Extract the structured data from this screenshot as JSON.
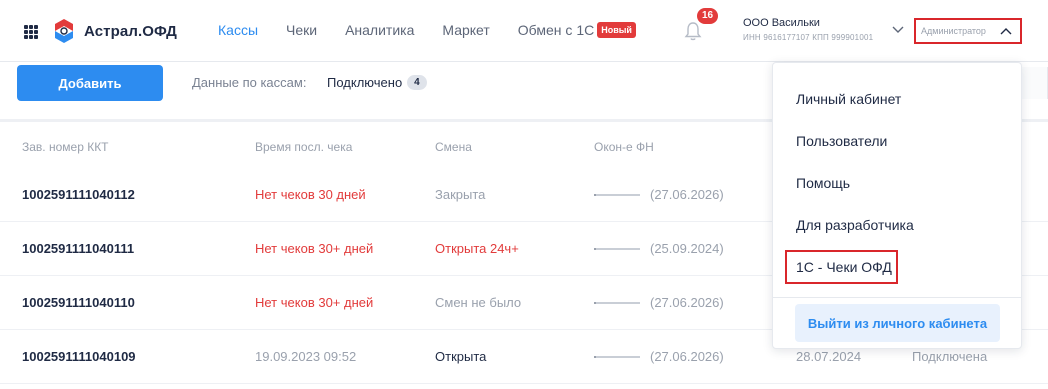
{
  "header": {
    "brand": "Астрал.ОФД",
    "nav": [
      {
        "label": "Кассы"
      },
      {
        "label": "Чеки"
      },
      {
        "label": "Аналитика"
      },
      {
        "label": "Маркет"
      },
      {
        "label": "Обмен с 1С",
        "badge": "Новый"
      }
    ],
    "notifications_count": "16",
    "org_name": "ООО Васильки",
    "org_ids": "ИНН 9616177107  КПП 999901001",
    "role": "Администратор"
  },
  "toolbar": {
    "add_label": "Добавить",
    "data_label": "Данные по кассам:",
    "connected_label": "Подключено",
    "connected_count": "4"
  },
  "table": {
    "columns": [
      "Зав. номер ККТ",
      "Время посл. чека",
      "Смена",
      "Окон-е ФН"
    ],
    "rows": [
      {
        "number": "1002591111040112",
        "last_check": "Нет чеков 30 дней",
        "shift": "Закрыта",
        "fn_end": "(27.06.2026)",
        "extra_date": "",
        "extra_status": ""
      },
      {
        "number": "1002591111040111",
        "last_check": "Нет чеков 30+ дней",
        "shift": "Открыта 24ч+",
        "fn_end": "(25.09.2024)",
        "extra_date": "",
        "extra_status": ""
      },
      {
        "number": "1002591111040110",
        "last_check": "Нет чеков 30+ дней",
        "shift": "Смен не было",
        "fn_end": "(27.06.2026)",
        "extra_date": "",
        "extra_status": ""
      },
      {
        "number": "1002591111040109",
        "last_check": "19.09.2023 09:52",
        "shift": "Открыта",
        "fn_end": "(27.06.2026)",
        "extra_date": "28.07.2024",
        "extra_status": "Подключена"
      }
    ]
  },
  "menu": {
    "items": [
      "Личный кабинет",
      "Пользователи",
      "Помощь",
      "Для разработчика",
      "1С - Чеки ОФД"
    ],
    "logout": "Выйти из личного кабинета"
  },
  "colors": {
    "accent": "#2d8cf0",
    "danger": "#e23b3b",
    "highlight_border": "#d9262b",
    "text": "#1f2a44",
    "muted": "#9aa1ad"
  }
}
